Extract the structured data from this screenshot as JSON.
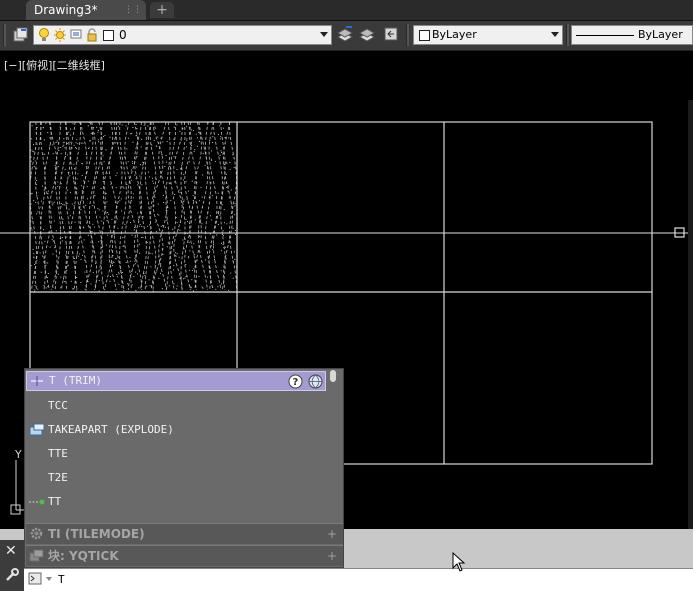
{
  "tabs": {
    "active_title": "Drawing3*",
    "new_tab": "+"
  },
  "toolbar": {
    "layer_value": "0",
    "color_value": "ByLayer",
    "linetype_value": "ByLayer"
  },
  "viewport": {
    "label": "[−][俯视][二维线框]"
  },
  "autocomplete": {
    "suggestions": [
      {
        "label": "T (TRIM)",
        "icon": "trim-icon",
        "selected": true
      },
      {
        "label": "TCC",
        "icon": "",
        "selected": false
      },
      {
        "label": "TAKEAPART (EXPLODE)",
        "icon": "explode-icon",
        "selected": false
      },
      {
        "label": "TTE",
        "icon": "",
        "selected": false
      },
      {
        "label": "T2E",
        "icon": "",
        "selected": false
      },
      {
        "label": "TT",
        "icon": "tracking-icon",
        "selected": false
      }
    ],
    "groups": [
      {
        "label": "TI (TILEMODE)",
        "icon": "gear-icon"
      },
      {
        "label": "块: YQTICK",
        "icon": "block-icon"
      }
    ]
  },
  "command_line": {
    "input_text": "T"
  },
  "colors": {
    "background": "#000000",
    "selected_row": "#a49bd0",
    "popup_bg": "#6a6a6a"
  }
}
